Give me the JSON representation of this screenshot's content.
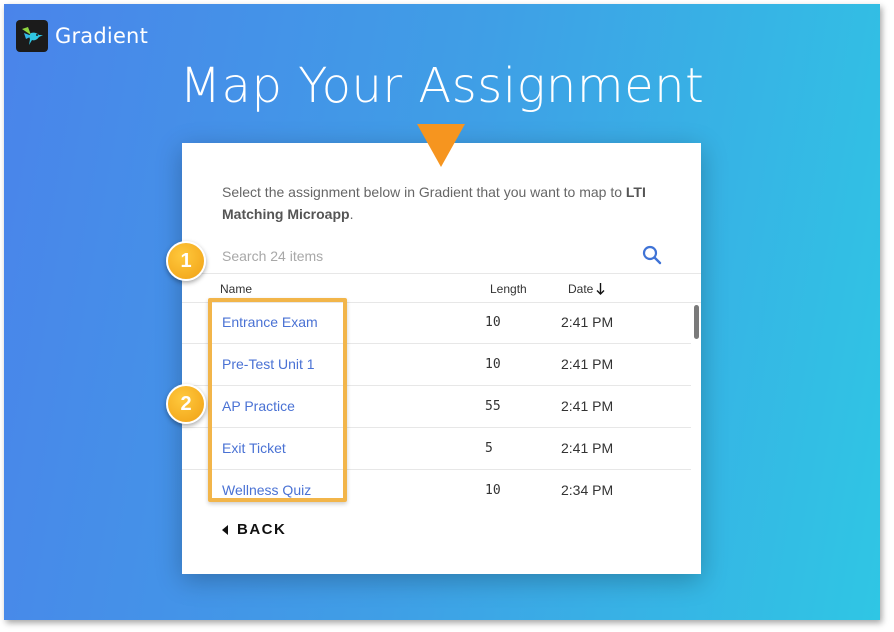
{
  "brand": {
    "name": "Gradient",
    "icon": "hummingbird-logo"
  },
  "page": {
    "title": "Map Your Assignment"
  },
  "instruction": {
    "text": "Select the assignment below in Gradient that you want to map to ",
    "target": "LTI Matching Microapp",
    "suffix": "."
  },
  "search": {
    "placeholder": "Search 24 items",
    "value": "",
    "icon": "search-icon"
  },
  "table": {
    "columns": {
      "name": "Name",
      "length": "Length",
      "date": "Date"
    },
    "sort": {
      "column": "date",
      "direction": "descending",
      "icon": "arrow-down-icon"
    },
    "rows": [
      {
        "name": "Entrance Exam",
        "length": "10",
        "date": "2:41 PM"
      },
      {
        "name": "Pre-Test Unit 1",
        "length": "10",
        "date": "2:41 PM"
      },
      {
        "name": "AP Practice",
        "length": "55",
        "date": "2:41 PM"
      },
      {
        "name": "Exit Ticket",
        "length": "5",
        "date": "2:41 PM"
      },
      {
        "name": "Wellness Quiz",
        "length": "10",
        "date": "2:34 PM"
      }
    ]
  },
  "back_button": {
    "label": "BACK"
  },
  "annotations": {
    "badge_1": "1",
    "badge_2": "2"
  },
  "colors": {
    "accent_orange": "#f6951f",
    "badge_yellow": "#f6b128",
    "link_blue": "#4a72d4",
    "gradient_start": "#4a84ea",
    "gradient_end": "#2fc6e4"
  }
}
